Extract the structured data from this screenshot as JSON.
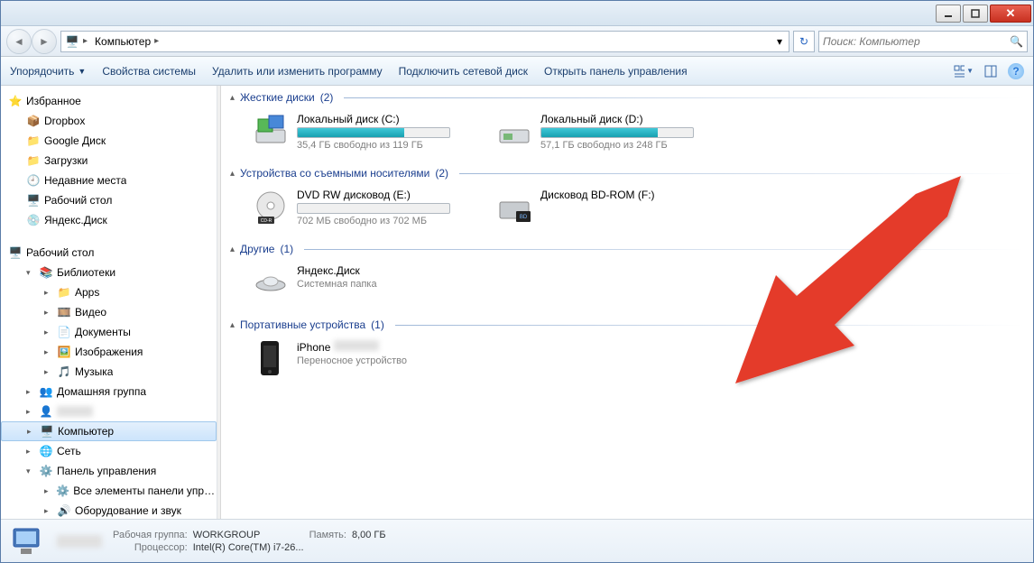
{
  "titlebar": {},
  "nav": {
    "breadcrumb_root": "Компьютер",
    "search_placeholder": "Поиск: Компьютер"
  },
  "toolbar": {
    "organize": "Упорядочить",
    "system_props": "Свойства системы",
    "uninstall": "Удалить или изменить программу",
    "map_drive": "Подключить сетевой диск",
    "control_panel": "Открыть панель управления"
  },
  "sidebar": {
    "favorites": "Избранное",
    "fav_items": [
      "Dropbox",
      "Google Диск",
      "Загрузки",
      "Недавние места",
      "Рабочий стол",
      "Яндекс.Диск"
    ],
    "desktop": "Рабочий стол",
    "libraries": "Библиотеки",
    "lib_items": [
      "Apps",
      "Видео",
      "Документы",
      "Изображения",
      "Музыка"
    ],
    "homegroup": "Домашняя группа",
    "user_blurred": "",
    "computer": "Компьютер",
    "network": "Сеть",
    "control_panel": "Панель управления",
    "cp_items": [
      "Все элементы панели управле",
      "Оборудование и звук"
    ]
  },
  "groups": {
    "hdd": {
      "title": "Жесткие диски",
      "count": "(2)"
    },
    "removable": {
      "title": "Устройства со съемными носителями",
      "count": "(2)"
    },
    "other": {
      "title": "Другие",
      "count": "(1)"
    },
    "portable": {
      "title": "Портативные устройства",
      "count": "(1)"
    }
  },
  "drives": {
    "c": {
      "name": "Локальный диск (C:)",
      "sub": "35,4 ГБ свободно из 119 ГБ",
      "fill": 70
    },
    "d": {
      "name": "Локальный диск (D:)",
      "sub": "57,1 ГБ свободно из 248 ГБ",
      "fill": 77
    },
    "dvd": {
      "name": "DVD RW дисковод (E:)",
      "sub": "702 МБ свободно из 702 МБ",
      "fill": 0
    },
    "bd": {
      "name": "Дисковод BD-ROM (F:)",
      "sub": ""
    },
    "yd": {
      "name": "Яндекс.Диск",
      "sub": "Системная папка"
    },
    "iphone": {
      "name": "iPhone",
      "sub": "Переносное устройство"
    }
  },
  "status": {
    "workgroup_label": "Рабочая группа:",
    "workgroup": "WORKGROUP",
    "processor_label": "Процессор:",
    "processor": "Intel(R) Core(TM) i7-26...",
    "memory_label": "Память:",
    "memory": "8,00 ГБ"
  }
}
